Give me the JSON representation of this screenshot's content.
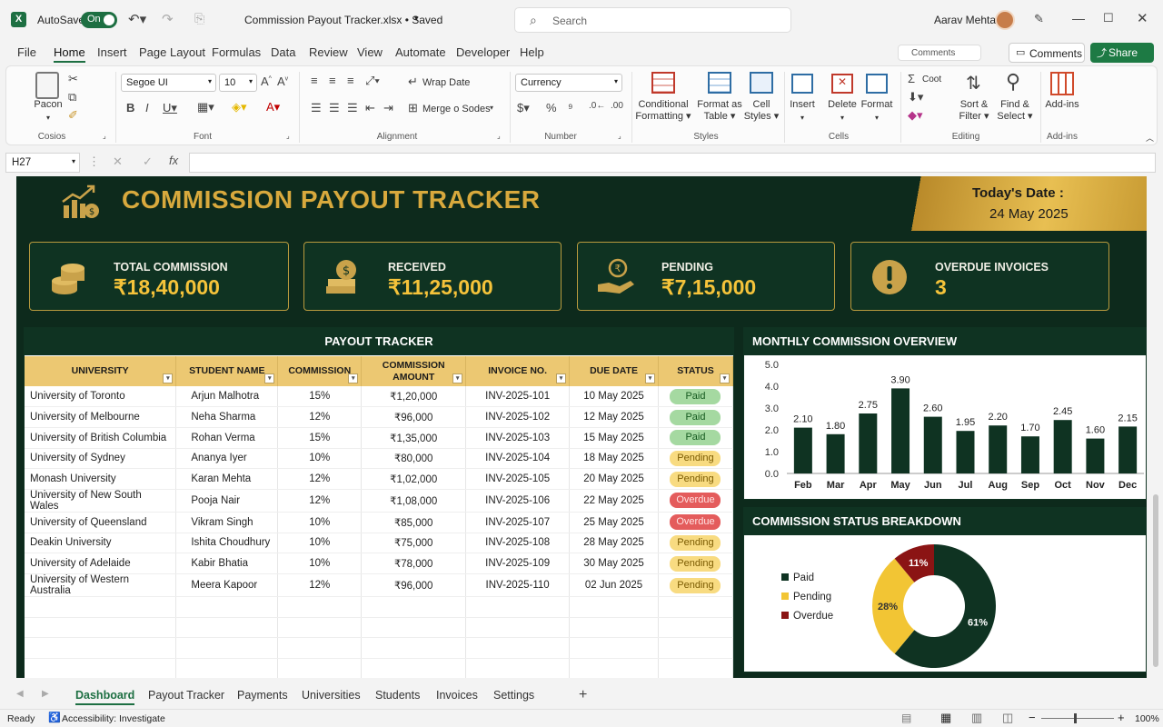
{
  "app": {
    "autosave": "AutoSave",
    "autosave_state": "On",
    "file_title": "Commission Payout Tracker.xlsx • Saved",
    "search_placeholder": "Search",
    "user": "Aarav Mehta"
  },
  "menu": [
    "File",
    "Home",
    "Insert",
    "Page Layout",
    "Formulas",
    "Data",
    "Review",
    "View",
    "Automate",
    "Developer",
    "Help"
  ],
  "menu_right": {
    "comments": "Comments",
    "share": "Share",
    "mode": "Comments"
  },
  "ribbon": {
    "clipboard": {
      "paste": "Pacon",
      "label": "Cosios"
    },
    "font": {
      "name": "Segoe UI",
      "size": "10",
      "label": "Font"
    },
    "alignment": {
      "wrap": "Wrap Date",
      "merge": "Merge o Sodes",
      "label": "Alignment"
    },
    "number": {
      "format": "Currency",
      "label": "Number"
    },
    "styles": {
      "conditional": [
        "Conditional",
        "Formatting"
      ],
      "format_table": [
        "Format as",
        "Table"
      ],
      "cell_styles": [
        "Cell",
        "Styles"
      ],
      "label": "Styles"
    },
    "cells": {
      "insert": "Insert",
      "delete": "Delete",
      "format": "Format",
      "label": "Cells"
    },
    "editing": {
      "sum": "Coot",
      "sort": [
        "Sort &",
        "Filter"
      ],
      "find": [
        "Find &",
        "Select"
      ],
      "label": "Editing"
    },
    "addins": {
      "button": "Add-ins",
      "label": "Add-ins"
    }
  },
  "formula_bar": {
    "cell_ref": "H27",
    "formula": ""
  },
  "dashboard": {
    "title": "COMMISSION PAYOUT TRACKER",
    "date_label": "Today's Date :",
    "date_value": "24 May 2025",
    "kpis": [
      {
        "label": "TOTAL COMMISSION",
        "value": "₹18,40,000",
        "icon": "coin-stack-icon"
      },
      {
        "label": "RECEIVED",
        "value": "₹11,25,000",
        "icon": "money-bag-icon"
      },
      {
        "label": "PENDING",
        "value": "₹7,15,000",
        "icon": "hand-coin-icon"
      },
      {
        "label": "OVERDUE INVOICES",
        "value": "3",
        "icon": "alert-icon"
      }
    ],
    "tracker": {
      "title": "PAYOUT TRACKER",
      "columns": [
        "UNIVERSITY",
        "STUDENT NAME",
        "COMMISSION",
        "COMMISSION AMOUNT",
        "INVOICE NO.",
        "DUE DATE",
        "STATUS"
      ],
      "rows": [
        [
          "University of Toronto",
          "Arjun Malhotra",
          "15%",
          "₹1,20,000",
          "INV-2025-101",
          "10 May 2025",
          "Paid"
        ],
        [
          "University of Melbourne",
          "Neha Sharma",
          "12%",
          "₹96,000",
          "INV-2025-102",
          "12 May 2025",
          "Paid"
        ],
        [
          "University of British Columbia",
          "Rohan Verma",
          "15%",
          "₹1,35,000",
          "INV-2025-103",
          "15 May 2025",
          "Paid"
        ],
        [
          "University of Sydney",
          "Ananya Iyer",
          "10%",
          "₹80,000",
          "INV-2025-104",
          "18 May 2025",
          "Pending"
        ],
        [
          "Monash University",
          "Karan Mehta",
          "12%",
          "₹1,02,000",
          "INV-2025-105",
          "20 May 2025",
          "Pending"
        ],
        [
          "University of New South Wales",
          "Pooja Nair",
          "12%",
          "₹1,08,000",
          "INV-2025-106",
          "22 May 2025",
          "Overdue"
        ],
        [
          "University of Queensland",
          "Vikram Singh",
          "10%",
          "₹85,000",
          "INV-2025-107",
          "25 May 2025",
          "Overdue"
        ],
        [
          "Deakin University",
          "Ishita Choudhury",
          "10%",
          "₹75,000",
          "INV-2025-108",
          "28 May 2025",
          "Pending"
        ],
        [
          "University of Adelaide",
          "Kabir Bhatia",
          "10%",
          "₹78,000",
          "INV-2025-109",
          "30 May 2025",
          "Pending"
        ],
        [
          "University of Western Australia",
          "Meera Kapoor",
          "12%",
          "₹96,000",
          "INV-2025-110",
          "02 Jun 2025",
          "Pending"
        ]
      ]
    }
  },
  "chart_data": [
    {
      "type": "bar",
      "title": "MONTHLY COMMISSION OVERVIEW",
      "categories": [
        "Feb",
        "Mar",
        "Apr",
        "May",
        "Jun",
        "Jul",
        "Aug",
        "Sep",
        "Oct",
        "Nov",
        "Dec"
      ],
      "values": [
        2.1,
        1.8,
        2.75,
        3.9,
        2.6,
        1.95,
        2.2,
        1.7,
        2.45,
        1.6,
        2.15
      ],
      "ylim": [
        0,
        5
      ],
      "yticks": [
        "0.0",
        "1.0",
        "2.0",
        "3.0",
        "4.0",
        "5.0"
      ],
      "grid": false,
      "bar_color": "#0f3322"
    },
    {
      "type": "pie",
      "title": "COMMISSION STATUS BREAKDOWN",
      "labels": [
        "Paid",
        "Pending",
        "Overdue"
      ],
      "values": [
        61,
        28,
        11
      ],
      "value_labels": [
        "61%",
        "28%",
        "11%"
      ],
      "colors": [
        "#0f3322",
        "#f2c534",
        "#8b1414"
      ],
      "legend": "left"
    }
  ],
  "sheet_tabs": [
    "Dashboard",
    "Payout Tracker",
    "Payments",
    "Universities",
    "Students",
    "Invoices",
    "Settings"
  ],
  "status": {
    "ready": "Ready",
    "accessibility": "Accessibility: Investigate",
    "zoom": "100%"
  }
}
